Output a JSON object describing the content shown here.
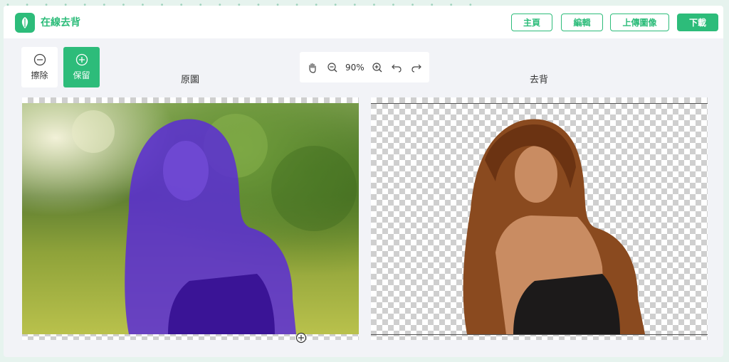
{
  "brand": {
    "name": "在線去背",
    "color": "#2dbc7a"
  },
  "nav": {
    "home": "主頁",
    "edit": "編輯",
    "upload": "上傳圖像",
    "download": "下載"
  },
  "tools": {
    "erase": {
      "label": "擦除",
      "icon": "minus-circle-icon"
    },
    "keep": {
      "label": "保留",
      "icon": "plus-circle-icon"
    }
  },
  "zoom": {
    "level": "90%",
    "icons": [
      "hand-icon",
      "zoom-out-icon",
      "zoom-in-icon",
      "undo-icon",
      "redo-icon"
    ]
  },
  "panels": {
    "original_title": "原圖",
    "result_title": "去背"
  },
  "colors": {
    "accent": "#2dbc7a",
    "keep_mask": "#5a2bd6"
  }
}
